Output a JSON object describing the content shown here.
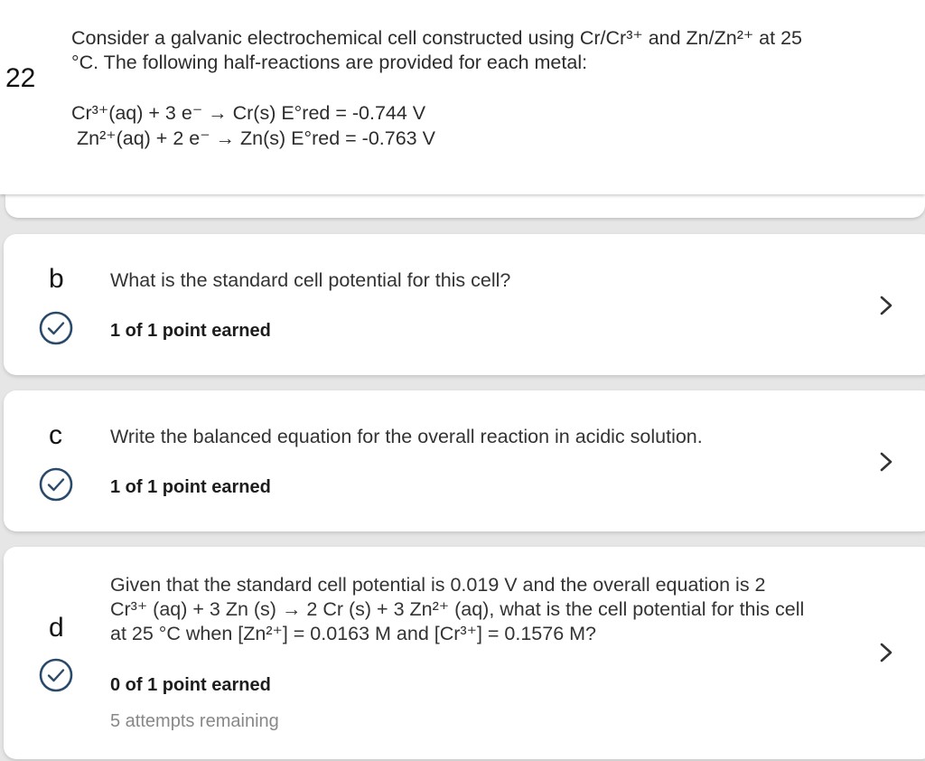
{
  "question": {
    "number": "22",
    "prompt_line1": "Consider a galvanic electrochemical cell constructed using Cr/Cr³⁺ and Zn/Zn²⁺ at 25",
    "prompt_line2": "°C. The following half-reactions are provided for each metal:",
    "reaction1": "Cr³⁺(aq) + 3 e⁻ → Cr(s) E°red = -0.744 V",
    "reaction2": "Zn²⁺(aq) + 2 e⁻ → Zn(s) E°red = -0.763 V"
  },
  "parts": [
    {
      "letter": "b",
      "question": "What is the standard cell potential for this cell?",
      "points": "1 of 1 point earned"
    },
    {
      "letter": "c",
      "question": "Write the balanced equation for the overall reaction in acidic solution.",
      "points": "1 of 1 point earned"
    },
    {
      "letter": "d",
      "question_line1": "Given that the standard cell potential is 0.019 V and the overall equation is 2",
      "question_line2": "Cr³⁺ (aq) + 3 Zn (s) → 2 Cr (s) + 3 Zn²⁺ (aq), what is the cell potential for this cell",
      "question_line3": "at 25 °C when [Zn²⁺] = 0.0163 M and [Cr³⁺] = 0.1576 M?",
      "points": "0 of 1 point earned",
      "attempts": "5 attempts remaining"
    }
  ],
  "colors": {
    "check_accent": "#2a4a6b",
    "page_bg": "#e6e6e6",
    "card_bg": "#ffffff"
  },
  "icons": {
    "status": "check-circle-icon",
    "expand": "chevron-right-icon"
  }
}
